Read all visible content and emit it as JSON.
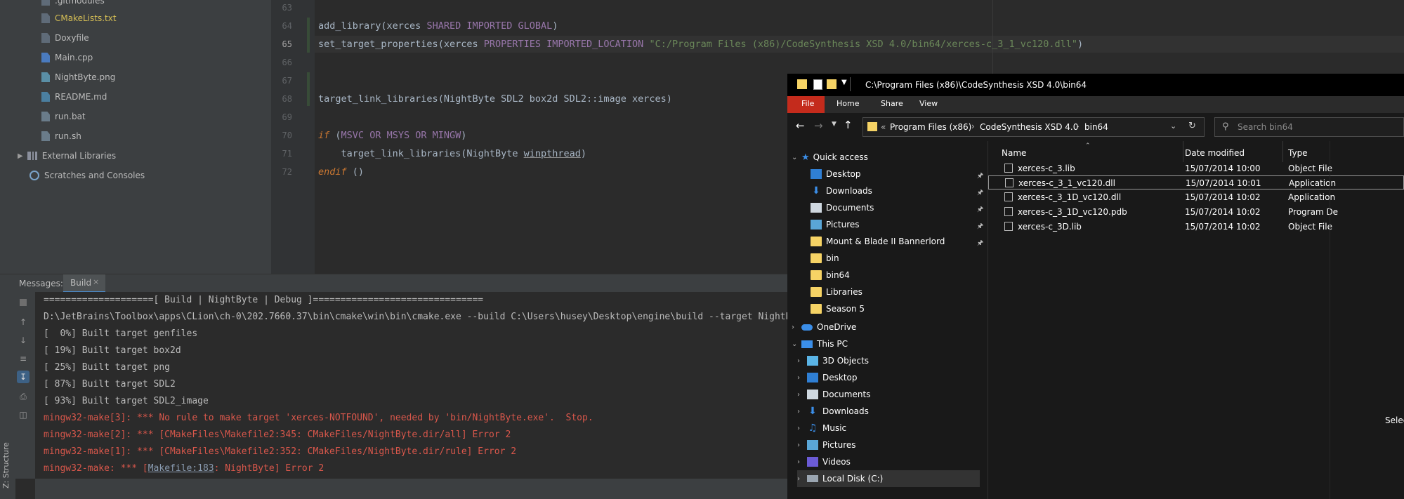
{
  "project_tree": {
    "items": [
      {
        "label": ".gitmodules",
        "icon": "git-file-icon"
      },
      {
        "label": "CMakeLists.txt",
        "icon": "cmake-file-icon"
      },
      {
        "label": "Doxyfile",
        "icon": "text-file-icon"
      },
      {
        "label": "Main.cpp",
        "icon": "cpp-file-icon"
      },
      {
        "label": "NightByte.png",
        "icon": "image-file-icon"
      },
      {
        "label": "README.md",
        "icon": "markdown-file-icon"
      },
      {
        "label": "run.bat",
        "icon": "batch-file-icon"
      },
      {
        "label": "run.sh",
        "icon": "shell-file-icon"
      },
      {
        "label": "External Libraries",
        "icon": "library-icon"
      },
      {
        "label": "Scratches and Consoles",
        "icon": "scratches-icon"
      }
    ]
  },
  "editor": {
    "line_numbers": [
      "63",
      "64",
      "65",
      "66",
      "67",
      "68",
      "69",
      "70",
      "71",
      "72"
    ],
    "current_line": "65",
    "lines": {
      "l64": {
        "fn": "add_library",
        "p1": "(xerces ",
        "k1": "SHARED",
        "s1": " ",
        "k2": "IMPORTED",
        "s2": " ",
        "k3": "GLOBAL",
        "p2": ")"
      },
      "l65": {
        "fn": "set_target_properties",
        "p1": "(xerces ",
        "k1": "PROPERTIES",
        "s1": " ",
        "k2": "IMPORTED_LOCATION",
        "s2": " ",
        "str": "\"C:/Program Files (x86)/CodeSynthesis XSD 4.0/bin64/xerces-c_3_1_vc120.dll\"",
        "p2": ")"
      },
      "l68": {
        "fn": "target_link_libraries",
        "p1": "(NightByte SDL2 box2d SDL2::image xerces)"
      },
      "l70": {
        "k0": "if",
        "p1": " (",
        "k1": "MSVC",
        "s1": " ",
        "k2": "OR",
        "s2": " ",
        "k3": "MSYS",
        "s3": " ",
        "k4": "OR",
        "s4": " ",
        "k5": "MINGW",
        "p2": ")"
      },
      "l71": {
        "indent": "    ",
        "fn": "target_link_libraries",
        "p1": "(NightByte ",
        "u": "winpthread",
        "p2": ")"
      },
      "l72": {
        "k0": "endif",
        "p1": " ()"
      }
    }
  },
  "tool_window": {
    "messages_label": "Messages:",
    "build_tab": "Build",
    "close_glyph": "×",
    "structure_label": "Z: Structure",
    "output": [
      {
        "text": "====================[ Build | NightByte | Debug ]===============================",
        "kind": "normal"
      },
      {
        "text": "D:\\JetBrains\\Toolbox\\apps\\CLion\\ch-0\\202.7660.37\\bin\\cmake\\win\\bin\\cmake.exe --build C:\\Users\\husey\\Desktop\\engine\\build --target NightByte",
        "kind": "normal"
      },
      {
        "text": "[  0%] Built target genfiles",
        "kind": "normal"
      },
      {
        "text": "[ 19%] Built target box2d",
        "kind": "normal"
      },
      {
        "text": "[ 25%] Built target png",
        "kind": "normal"
      },
      {
        "text": "[ 87%] Built target SDL2",
        "kind": "normal"
      },
      {
        "text": "[ 93%] Built target SDL2_image",
        "kind": "normal"
      },
      {
        "text": "mingw32-make[3]: *** No rule to make target 'xerces-NOTFOUND', needed by 'bin/NightByte.exe'.  Stop.",
        "kind": "error"
      },
      {
        "text": "mingw32-make[2]: *** [CMakeFiles\\Makefile2:345: CMakeFiles/NightByte.dir/all] Error 2",
        "kind": "error"
      },
      {
        "text": "mingw32-make[1]: *** [CMakeFiles\\Makefile2:352: CMakeFiles/NightByte.dir/rule] Error 2",
        "kind": "error"
      }
    ],
    "last_line": {
      "prefix": "mingw32-make: *** [",
      "link": "Makefile:183",
      "suffix": ": NightByte] Error 2"
    }
  },
  "explorer": {
    "title": "C:\\Program Files (x86)\\CodeSynthesis XSD 4.0\\bin64",
    "ribbon_tabs": [
      "File",
      "Home",
      "Share",
      "View"
    ],
    "breadcrumb_prefix": "«",
    "breadcrumb": [
      "Program Files (x86)",
      "CodeSynthesis XSD 4.0",
      "bin64"
    ],
    "search_placeholder": "Search bin64",
    "nav": {
      "quick_access": "Quick access",
      "pinned": [
        "Desktop",
        "Downloads",
        "Documents",
        "Pictures",
        "Mount & Blade II Bannerlord"
      ],
      "recent": [
        "bin",
        "bin64",
        "Libraries",
        "Season 5"
      ],
      "onedrive": "OneDrive",
      "this_pc": "This PC",
      "pc_items": [
        "3D Objects",
        "Desktop",
        "Documents",
        "Downloads",
        "Music",
        "Pictures",
        "Videos",
        "Local Disk (C:)"
      ]
    },
    "columns": {
      "name": "Name",
      "date": "Date modified",
      "type": "Type"
    },
    "files": [
      {
        "name": "xerces-c_3.lib",
        "date": "15/07/2014 10:00",
        "type": "Object File"
      },
      {
        "name": "xerces-c_3_1_vc120.dll",
        "date": "15/07/2014 10:01",
        "type": "Application"
      },
      {
        "name": "xerces-c_3_1D_vc120.dll",
        "date": "15/07/2014 10:02",
        "type": "Application"
      },
      {
        "name": "xerces-c_3_1D_vc120.pdb",
        "date": "15/07/2014 10:02",
        "type": "Program De"
      },
      {
        "name": "xerces-c_3D.lib",
        "date": "15/07/2014 10:02",
        "type": "Object File"
      }
    ],
    "selected_file_index": 1,
    "right_edge_text": "Selec"
  }
}
